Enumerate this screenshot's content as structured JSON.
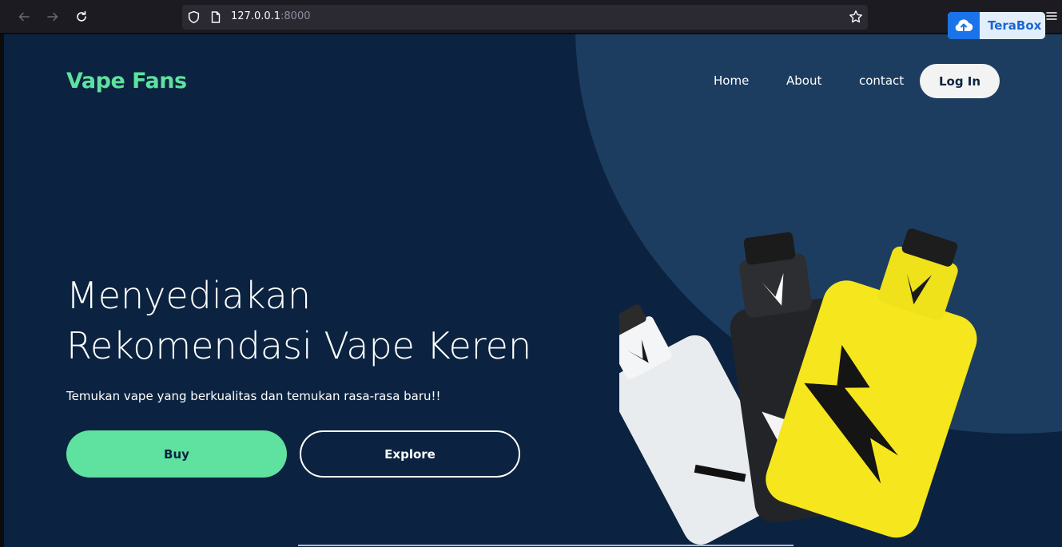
{
  "browser": {
    "url_host": "127.0.0.1",
    "url_port": ":8000",
    "extension_label": "TeraBox"
  },
  "site": {
    "brand": "Vape Fans",
    "nav": {
      "home": "Home",
      "about": "About",
      "contact": "contact",
      "login": "Log In"
    },
    "hero": {
      "title_line1": "Menyediakan",
      "title_line2": "Rekomendasi Vape Keren",
      "subtitle": "Temukan vape yang berkualitas dan temukan rasa-rasa baru!!",
      "buy_label": "Buy",
      "explore_label": "Explore"
    }
  },
  "colors": {
    "background": "#0b2340",
    "accent_circle": "#1d3d60",
    "brand_green": "#5fe1a0",
    "terabox_blue": "#1a73e8"
  },
  "icons": [
    "back-arrow-icon",
    "forward-arrow-icon",
    "reload-icon",
    "shield-icon",
    "page-icon",
    "star-icon",
    "menu-icon",
    "cloud-upload-icon"
  ]
}
